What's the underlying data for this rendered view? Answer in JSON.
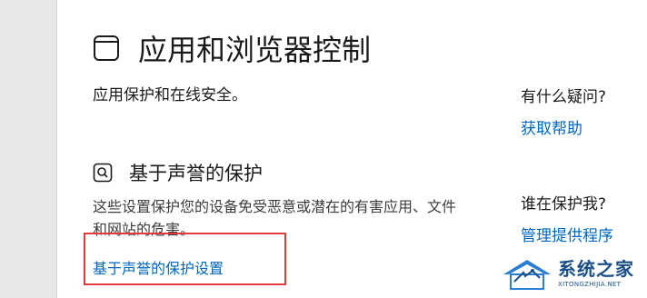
{
  "header": {
    "title": "应用和浏览器控制",
    "icon": "app-browser-window-icon"
  },
  "description": "应用保护和在线安全。",
  "reputation_section": {
    "icon": "reputation-search-icon",
    "title": "基于声誉的保护",
    "description": "这些设置保护您的设备免受恶意或潜在的有害应用、文件和网站的危害。",
    "settings_link": "基于声誉的保护设置"
  },
  "sidebar": {
    "help_heading": "有什么疑问?",
    "help_link": "获取帮助",
    "protect_heading": "谁在保护我?",
    "protect_link": "管理提供程序"
  },
  "annotation": {
    "highlight_color": "#e03a3a"
  },
  "watermark": {
    "name": "系统之家",
    "domain": "XITONGZHIJIA.NET"
  },
  "colors": {
    "link": "#0067c0",
    "nav_background": "#e8e8e8",
    "watermark": "#1a4f8a"
  }
}
